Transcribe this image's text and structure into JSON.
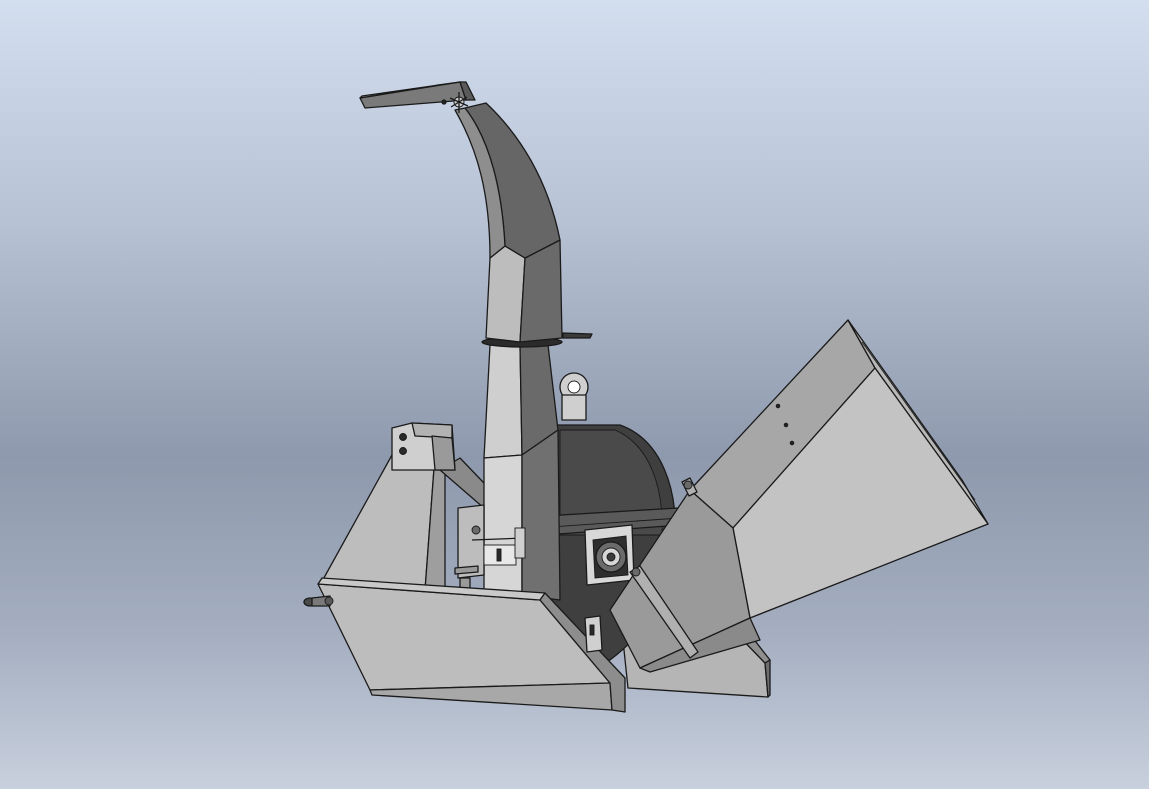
{
  "viewport": {
    "content": "3d-cad-model",
    "model": "wood-chipper",
    "background": {
      "top": "#d3deef",
      "middle": "#8e99ad",
      "bottom": "#c8d0dd"
    }
  },
  "colors": {
    "light_face": "#c9c9c9",
    "mid_face": "#a8a8a8",
    "dark_face": "#555555",
    "darker_face": "#3d3d3d",
    "edge": "#1a1a1a"
  }
}
